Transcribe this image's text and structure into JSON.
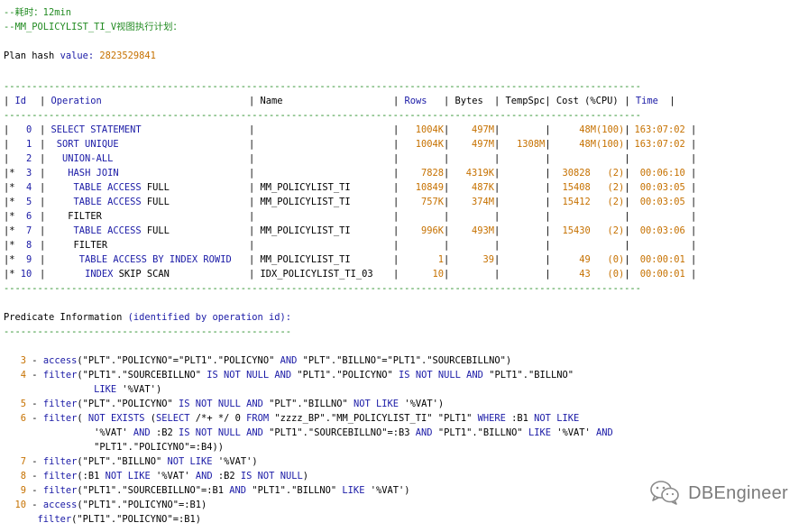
{
  "header": {
    "comment_time": "--耗时：12min",
    "comment_view": "--MM_POLICYLIST_TI_V视图执行计划：",
    "plan_hash_label": "Plan hash ",
    "plan_hash_key": "value:",
    "plan_hash_value": "2823529841"
  },
  "plan": {
    "separator": "-----------------------------------------------------------------------------------------------------------------",
    "columns": [
      "Id",
      "Operation",
      "Name",
      "Rows",
      "Bytes",
      "TempSpc",
      "Cost (%CPU)",
      "Time"
    ],
    "rows": [
      {
        "mark": " ",
        "id": "0",
        "op_k": "SELECT STATEMENT",
        "op_p": "",
        "indent": 0,
        "name": "",
        "rows": "1004K",
        "bytes": "497M",
        "temp": "",
        "cost": "48M(100)",
        "time": "163:07:02"
      },
      {
        "mark": " ",
        "id": "1",
        "op_k": "SORT UNIQUE",
        "op_p": "",
        "indent": 1,
        "name": "",
        "rows": "1004K",
        "bytes": "497M",
        "temp": "1308M",
        "cost": "48M(100)",
        "time": "163:07:02"
      },
      {
        "mark": " ",
        "id": "2",
        "op_k": "UNION-ALL",
        "op_p": "",
        "indent": 2,
        "name": "",
        "rows": "",
        "bytes": "",
        "temp": "",
        "cost": "",
        "time": ""
      },
      {
        "mark": "*",
        "id": "3",
        "op_k": "HASH JOIN",
        "op_p": "",
        "indent": 3,
        "name": "",
        "rows": "7828",
        "bytes": "4319K",
        "temp": "",
        "cost": "30828   (2)",
        "time": "00:06:10"
      },
      {
        "mark": "*",
        "id": "4",
        "op_k": "TABLE ACCESS",
        "op_p": " FULL",
        "indent": 4,
        "name": "MM_POLICYLIST_TI",
        "rows": "10849",
        "bytes": "487K",
        "temp": "",
        "cost": "15408   (2)",
        "time": "00:03:05"
      },
      {
        "mark": "*",
        "id": "5",
        "op_k": "TABLE ACCESS",
        "op_p": " FULL",
        "indent": 4,
        "name": "MM_POLICYLIST_TI",
        "rows": "757K",
        "bytes": "374M",
        "temp": "",
        "cost": "15412   (2)",
        "time": "00:03:05"
      },
      {
        "mark": "*",
        "id": "6",
        "op_k": "",
        "op_p": "FILTER",
        "indent": 3,
        "name": "",
        "rows": "",
        "bytes": "",
        "temp": "",
        "cost": "",
        "time": ""
      },
      {
        "mark": "*",
        "id": "7",
        "op_k": "TABLE ACCESS",
        "op_p": " FULL",
        "indent": 4,
        "name": "MM_POLICYLIST_TI",
        "rows": "996K",
        "bytes": "493M",
        "temp": "",
        "cost": "15430   (2)",
        "time": "00:03:06"
      },
      {
        "mark": "*",
        "id": "8",
        "op_k": "",
        "op_p": "FILTER",
        "indent": 4,
        "name": "",
        "rows": "",
        "bytes": "",
        "temp": "",
        "cost": "",
        "time": ""
      },
      {
        "mark": "*",
        "id": "9",
        "op_k": "TABLE ACCESS BY INDEX ROWID",
        "op_p": "",
        "indent": 5,
        "name": "MM_POLICYLIST_TI",
        "rows": "1",
        "bytes": "39",
        "temp": "",
        "cost": "49   (0)",
        "time": "00:00:01"
      },
      {
        "mark": "*",
        "id": "10",
        "op_k": "INDEX",
        "op_p": " SKIP SCAN",
        "indent": 6,
        "name": "IDX_POLICYLIST_TI_03",
        "rows": "10",
        "bytes": "",
        "temp": "",
        "cost": "43   (0)",
        "time": "00:00:01"
      }
    ]
  },
  "predicate": {
    "title_plain": "Predicate Information ",
    "title_paren": "(identified by operation id):",
    "underline": "---------------------------------------------------"
  },
  "predicates": [
    {
      "id": "3",
      "text": "access(\"PLT\".\"POLICYNO\"=\"PLT1\".\"POLICYNO\" AND \"PLT\".\"BILLNO\"=\"PLT1\".\"SOURCEBILLNO\")"
    },
    {
      "id": "4",
      "text": "filter(\"PLT1\".\"SOURCEBILLNO\" IS NOT NULL AND \"PLT1\".\"POLICYNO\" IS NOT NULL AND \"PLT1\".\"BILLNO\""
    },
    {
      "id": "",
      "text": "          LIKE '%VAT')"
    },
    {
      "id": "5",
      "text": "filter(\"PLT\".\"POLICYNO\" IS NOT NULL AND \"PLT\".\"BILLNO\" NOT LIKE '%VAT')"
    },
    {
      "id": "6",
      "text": "filter( NOT EXISTS (SELECT /*+ */ 0 FROM \"zzzz_BP\".\"MM_POLICYLIST_TI\" \"PLT1\" WHERE :B1 NOT LIKE"
    },
    {
      "id": "",
      "text": "          '%VAT' AND :B2 IS NOT NULL AND \"PLT1\".\"SOURCEBILLNO\"=:B3 AND \"PLT1\".\"BILLNO\" LIKE '%VAT' AND"
    },
    {
      "id": "",
      "text": "          \"PLT1\".\"POLICYNO\"=:B4))"
    },
    {
      "id": "7",
      "text": "filter(\"PLT\".\"BILLNO\" NOT LIKE '%VAT')"
    },
    {
      "id": "8",
      "text": "filter(:B1 NOT LIKE '%VAT' AND :B2 IS NOT NULL)"
    },
    {
      "id": "9",
      "text": "filter(\"PLT1\".\"SOURCEBILLNO\"=:B1 AND \"PLT1\".\"BILLNO\" LIKE '%VAT')"
    },
    {
      "id": "10",
      "text": "access(\"PLT1\".\"POLICYNO\"=:B1)"
    },
    {
      "id": "",
      "text": "filter(\"PLT1\".\"POLICYNO\"=:B1)"
    }
  ],
  "watermark": {
    "icon": "wechat-icon",
    "text": "DBEngineer"
  },
  "colors": {
    "comment": "#228b22",
    "keyword": "#1a1aa6",
    "number": "#c67100",
    "watermark": "#7a7a7a"
  }
}
